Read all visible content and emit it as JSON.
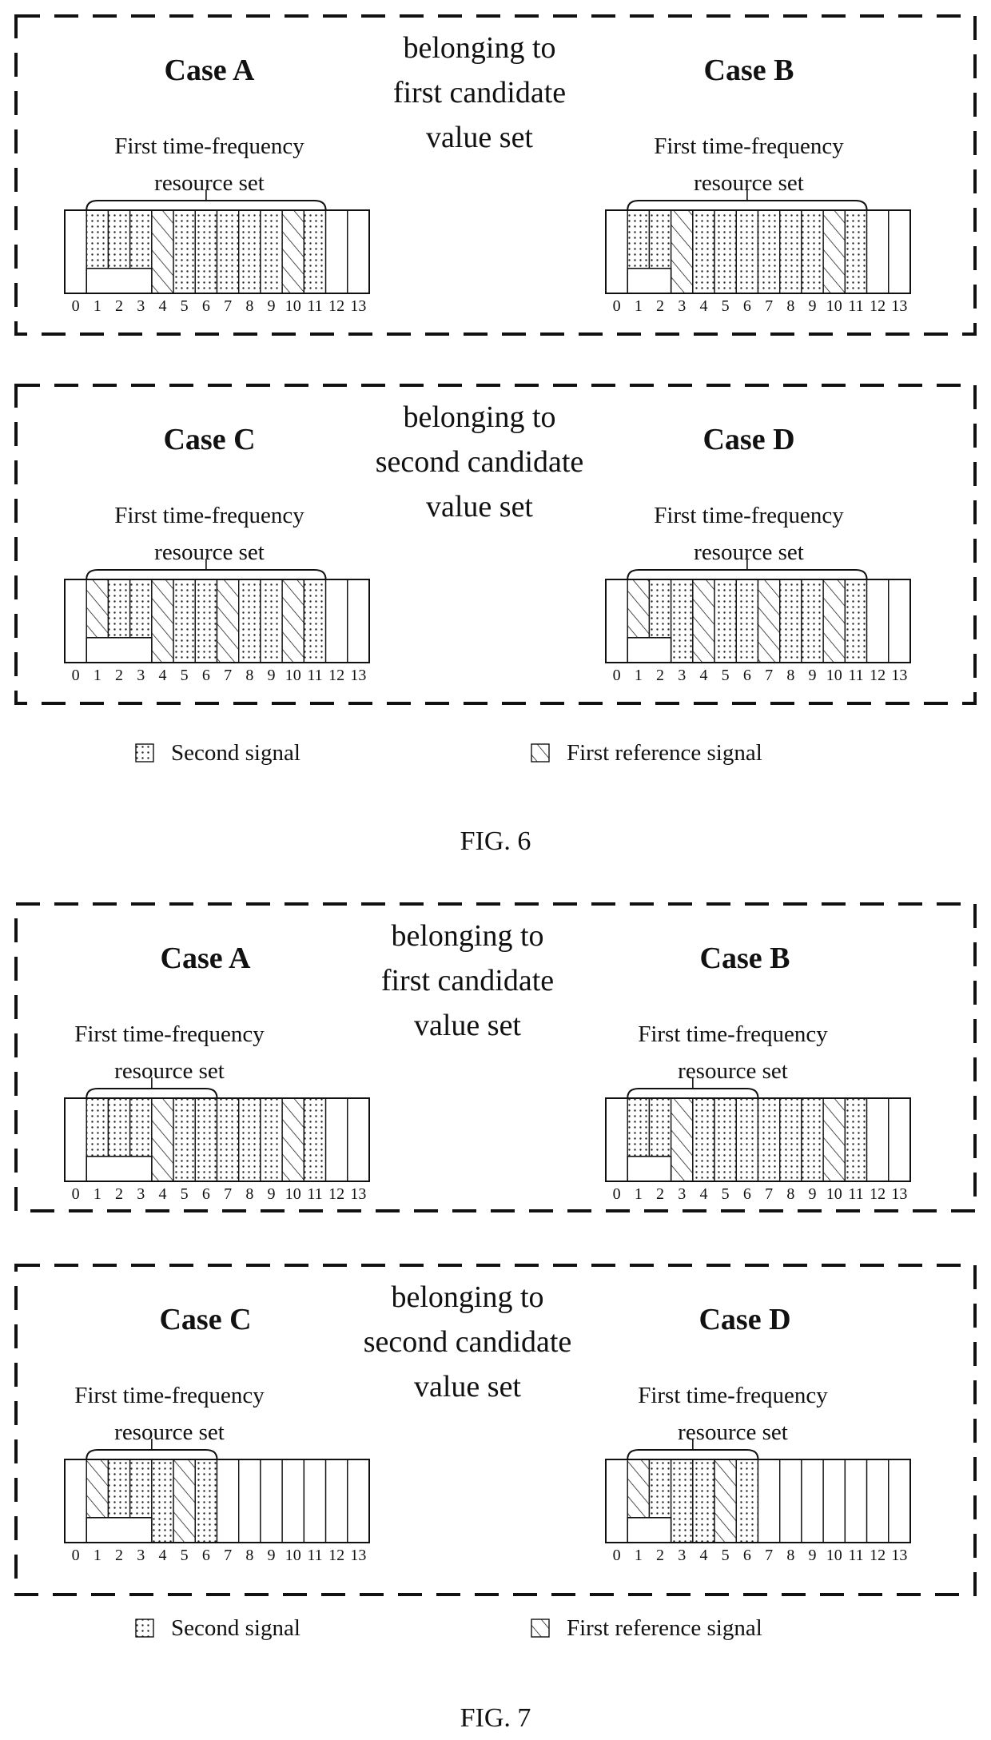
{
  "figures": [
    {
      "label": "FIG. 6",
      "groups": [
        {
          "middle_lines": [
            "belonging to",
            "first candidate",
            "value set"
          ],
          "cases": [
            {
              "title": "Case A",
              "rs_label": [
                "First time-frequency",
                "resource set"
              ],
              "brace": [
                1,
                11
              ],
              "cells": [
                "white",
                "dot",
                "dot",
                "dot",
                "hatch",
                "dot",
                "dot",
                "dot",
                "dot",
                "dot",
                "hatch",
                "dot",
                "white",
                "white"
              ],
              "blank_bottom": [
                1,
                3
              ]
            },
            {
              "title": "Case B",
              "rs_label": [
                "First time-frequency",
                "resource set"
              ],
              "brace": [
                1,
                11
              ],
              "cells": [
                "white",
                "dot",
                "dot",
                "hatch",
                "dot",
                "dot",
                "dot",
                "dot",
                "dot",
                "dot",
                "hatch",
                "dot",
                "white",
                "white"
              ],
              "blank_bottom": [
                1,
                2
              ]
            }
          ]
        },
        {
          "middle_lines": [
            "belonging to",
            "second candidate",
            "value set"
          ],
          "cases": [
            {
              "title": "Case C",
              "rs_label": [
                "First time-frequency",
                "resource set"
              ],
              "brace": [
                1,
                11
              ],
              "cells": [
                "white",
                "hatch",
                "dot",
                "dot",
                "hatch",
                "dot",
                "dot",
                "hatch",
                "dot",
                "dot",
                "hatch",
                "dot",
                "white",
                "white"
              ],
              "blank_bottom": [
                1,
                3
              ]
            },
            {
              "title": "Case D",
              "rs_label": [
                "First time-frequency",
                "resource set"
              ],
              "brace": [
                1,
                11
              ],
              "cells": [
                "white",
                "hatch",
                "dot",
                "dot",
                "hatch",
                "dot",
                "dot",
                "hatch",
                "dot",
                "dot",
                "hatch",
                "dot",
                "white",
                "white"
              ],
              "blank_bottom": [
                1,
                2
              ]
            }
          ]
        }
      ],
      "legend": [
        {
          "pattern": "dot",
          "label": "Second signal"
        },
        {
          "pattern": "hatch",
          "label": "First reference signal"
        }
      ]
    },
    {
      "label": "FIG. 7",
      "groups": [
        {
          "middle_lines": [
            "belonging to",
            "first candidate",
            "value set"
          ],
          "cases": [
            {
              "title": "Case A",
              "rs_label": [
                "First time-frequency",
                "resource set"
              ],
              "brace": [
                1,
                6
              ],
              "cells": [
                "white",
                "dot",
                "dot",
                "dot",
                "hatch",
                "dot",
                "dot",
                "dot",
                "dot",
                "dot",
                "hatch",
                "dot",
                "white",
                "white"
              ],
              "blank_bottom": [
                1,
                3
              ]
            },
            {
              "title": "Case B",
              "rs_label": [
                "First time-frequency",
                "resource set"
              ],
              "brace": [
                1,
                6
              ],
              "cells": [
                "white",
                "dot",
                "dot",
                "hatch",
                "dot",
                "dot",
                "dot",
                "dot",
                "dot",
                "dot",
                "hatch",
                "dot",
                "white",
                "white"
              ],
              "blank_bottom": [
                1,
                2
              ]
            }
          ]
        },
        {
          "middle_lines": [
            "belonging to",
            "second candidate",
            "value set"
          ],
          "cases": [
            {
              "title": "Case C",
              "rs_label": [
                "First time-frequency",
                "resource set"
              ],
              "brace": [
                1,
                6
              ],
              "cells": [
                "white",
                "hatch",
                "dot",
                "dot",
                "dot",
                "hatch",
                "dot",
                "white",
                "white",
                "white",
                "white",
                "white",
                "white",
                "white"
              ],
              "blank_bottom": [
                1,
                3
              ]
            },
            {
              "title": "Case D",
              "rs_label": [
                "First time-frequency",
                "resource set"
              ],
              "brace": [
                1,
                6
              ],
              "cells": [
                "white",
                "hatch",
                "dot",
                "dot",
                "dot",
                "hatch",
                "dot",
                "white",
                "white",
                "white",
                "white",
                "white",
                "white",
                "white"
              ],
              "blank_bottom": [
                1,
                2
              ]
            }
          ]
        }
      ],
      "legend": [
        {
          "pattern": "dot",
          "label": "Second signal"
        },
        {
          "pattern": "hatch",
          "label": "First reference signal"
        }
      ]
    }
  ],
  "symbol_indices": [
    "0",
    "1",
    "2",
    "3",
    "4",
    "5",
    "6",
    "7",
    "8",
    "9",
    "10",
    "11",
    "12",
    "13"
  ],
  "colors": {
    "ink": "#111111",
    "background": "#ffffff",
    "dot": "#333333"
  }
}
